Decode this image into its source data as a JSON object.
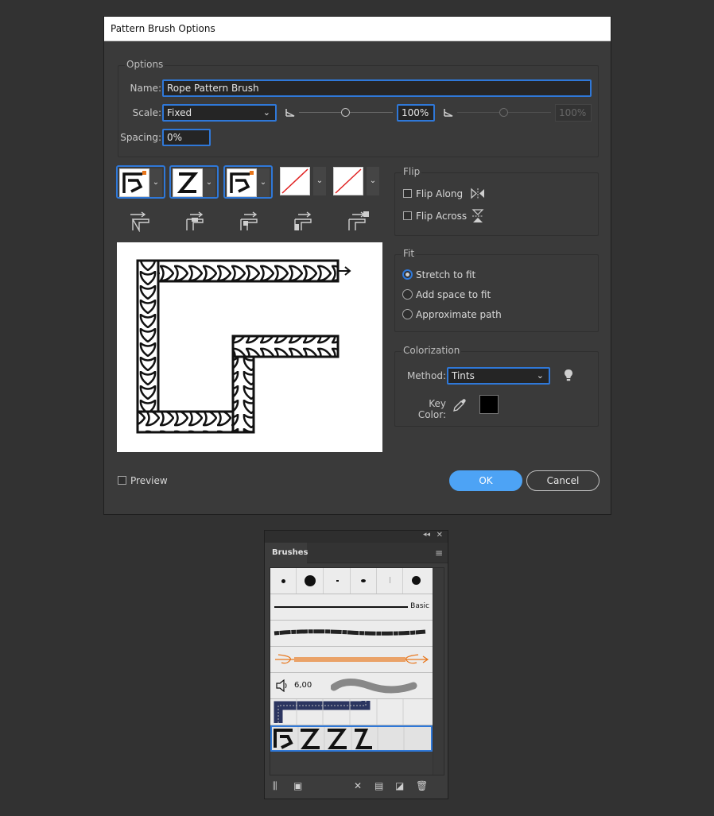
{
  "dialog": {
    "title": "Pattern Brush Options",
    "options": {
      "group_label": "Options",
      "name_label": "Name:",
      "name_value": "Rope Pattern Brush",
      "scale_label": "Scale:",
      "scale_value": "Fixed",
      "scale_percent": "100%",
      "scale_percent_disabled": "100%",
      "spacing_label": "Spacing:",
      "spacing_value": "0%"
    },
    "flip": {
      "group_label": "Flip",
      "flip_along": "Flip Along",
      "flip_across": "Flip Across"
    },
    "fit": {
      "group_label": "Fit",
      "stretch": "Stretch to fit",
      "add_space": "Add space to fit",
      "approximate": "Approximate path"
    },
    "colorization": {
      "group_label": "Colorization",
      "method_label": "Method:",
      "method_value": "Tints",
      "key_color_label": "Key Color:",
      "key_color": "#000000"
    },
    "preview_label": "Preview",
    "ok_label": "OK",
    "cancel_label": "Cancel"
  },
  "brushes_panel": {
    "tab_label": "Brushes",
    "basic_label": "Basic",
    "bristle_size": "6,00"
  },
  "colors": {
    "accent": "#2f78d8",
    "primary_button": "#4da3f5",
    "orange_marker": "#e8751a"
  }
}
